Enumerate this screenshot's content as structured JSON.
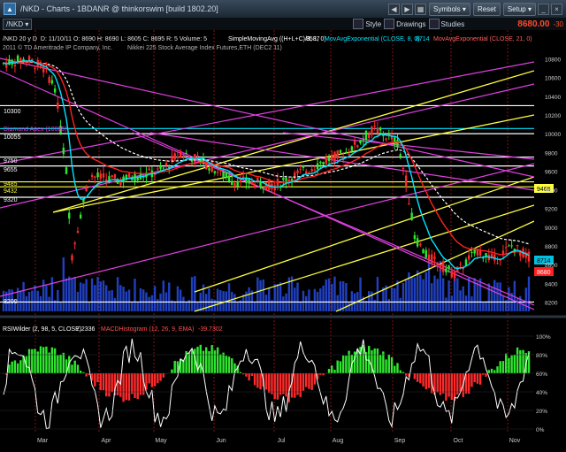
{
  "window": {
    "title": "/NKD - Charts - 1BDANR @ thinkorswim [build 1802.20]",
    "symbols_label": "Symbols",
    "reset_label": "Reset",
    "setup_label": "Setup"
  },
  "toolbar": {
    "symbol": "/NKD",
    "period": "20 y D",
    "style_label": "Style",
    "drawings_label": "Drawings",
    "studies_label": "Studies",
    "price": "8680.00",
    "change": "-30"
  },
  "info_line": {
    "header": "/NKD 20 y D",
    "ohlc": "D: 11/10/11  O: 8690  H: 8690  L: 8605  C: 8695  R: 5  Volume: 5",
    "study1": "SimpleMovingAvg ((H+L+C)/3, 1, 0)",
    "study1_value": "8587",
    "study2": "MovAvgExponential (CLOSE, 8, 0)",
    "study2_value": "8714",
    "study3": "MovAvgExponential (CLOSE, 21, 0)",
    "copyright": "2011 © TD Ameritrade IP Company, Inc.",
    "contract": "Nikkei 225 Stock Average Index Futures,ETH (DEC2 11)"
  },
  "price_annotations": {
    "level_10300": "10300",
    "diamond_apex": "Diamond Apex (10085)",
    "level_10055": "10055",
    "level_9750": "9750",
    "level_9655": "9655",
    "level_9485": "9485",
    "level_9432": "9432",
    "level_9320": "9320",
    "level_8200": "8200",
    "axis_tag_9469": "9469",
    "axis_tag_8714": "8714",
    "axis_tag_8680": "8680"
  },
  "lower_panel": {
    "rsi_label": "RSIWilder (2, 98, 5, CLOSE)",
    "rsi_value": "7.2336",
    "macd_label": "MACDHistogram (12, 26, 9, EMA)",
    "macd_value": "-39.7302"
  },
  "x_axis": {
    "months": [
      "Mar",
      "Apr",
      "May",
      "Jun",
      "Jul",
      "Aug",
      "Sep",
      "Oct",
      "Nov"
    ]
  },
  "price_axis": {
    "ticks": [
      "10800",
      "10600",
      "10400",
      "10200",
      "10000",
      "9800",
      "9600",
      "9400",
      "9200",
      "9000",
      "8800",
      "8600",
      "8400",
      "8200"
    ],
    "ylim": [
      8100,
      10900
    ]
  },
  "oscillator_axis": {
    "ticks": [
      "100%",
      "80%",
      "60%",
      "40%",
      "20%",
      "0%"
    ]
  },
  "colors": {
    "up_candle": "#2ee82e",
    "down_candle": "#ff2a2a",
    "ema8": "#00e5ff",
    "ema21": "#ff2020",
    "sma": "#ffffff",
    "channel": "#ffff40",
    "fan": "#e040e0",
    "volume": "#2040c0"
  }
}
